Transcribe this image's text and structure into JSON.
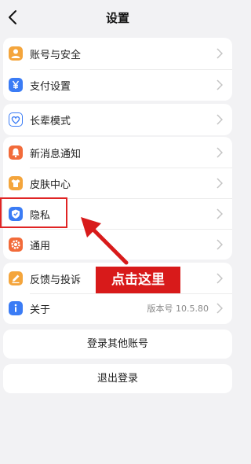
{
  "header": {
    "title": "设置"
  },
  "groups": [
    {
      "items": [
        {
          "label": "账号与安全",
          "icon": "user-icon",
          "color": "#f4a53c"
        },
        {
          "label": "支付设置",
          "icon": "yen-icon",
          "color": "#3b7cf5"
        }
      ]
    },
    {
      "items": [
        {
          "label": "长辈模式",
          "icon": "heart-shield-icon",
          "color": "#3b7cf5"
        }
      ]
    },
    {
      "items": [
        {
          "label": "新消息通知",
          "icon": "bell-icon",
          "color": "#f26b3a"
        },
        {
          "label": "皮肤中心",
          "icon": "shirt-icon",
          "color": "#f4a53c"
        },
        {
          "label": "隐私",
          "icon": "privacy-shield-icon",
          "color": "#3b7cf5"
        },
        {
          "label": "通用",
          "icon": "gear-icon",
          "color": "#f26b3a"
        }
      ]
    },
    {
      "items": [
        {
          "label": "反馈与投诉",
          "icon": "pencil-icon",
          "color": "#f4a53c"
        },
        {
          "label": "关于",
          "icon": "info-icon",
          "color": "#3b7cf5",
          "extra": "版本号 10.5.80"
        }
      ]
    }
  ],
  "buttons": {
    "switch_account": "登录其他账号",
    "logout": "退出登录"
  },
  "annotation": {
    "callout": "点击这里",
    "color": "#d81a1a"
  }
}
